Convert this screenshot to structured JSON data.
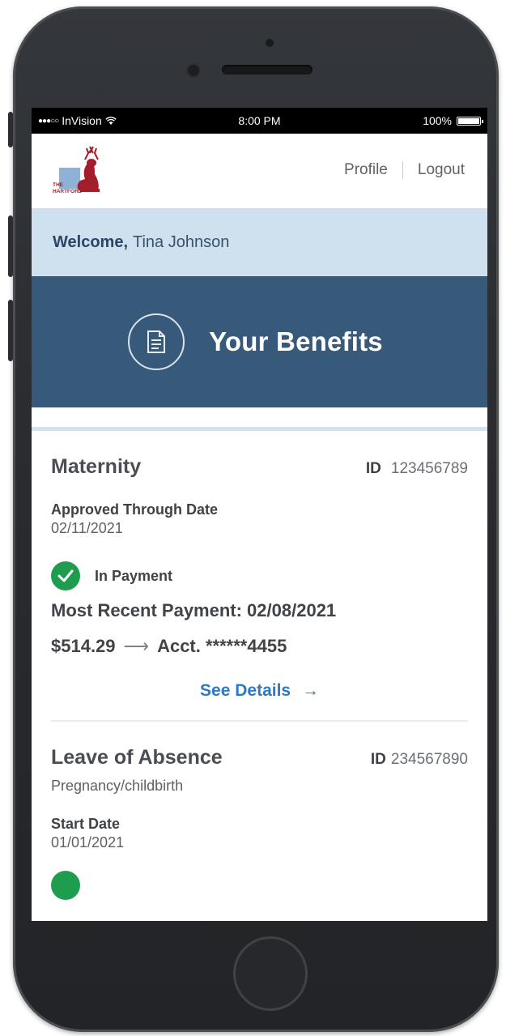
{
  "status_bar": {
    "carrier": "InVision",
    "signal_dots": "●●●○○",
    "time": "8:00 PM",
    "battery": "100%"
  },
  "header": {
    "logo_alt": "THE HARTFORD",
    "links": {
      "profile": "Profile",
      "logout": "Logout"
    }
  },
  "welcome": {
    "greeting": "Welcome,",
    "name": "Tina Johnson"
  },
  "hero": {
    "title": "Your Benefits",
    "icon": "document-icon"
  },
  "benefits": [
    {
      "title": "Maternity",
      "id_label": "ID",
      "id_value": "123456789",
      "approved_label": "Approved Through Date",
      "approved_value": "02/11/2021",
      "status": "In Payment",
      "recent_payment": "Most Recent Payment: 02/08/2021",
      "amount": "$514.29",
      "account": "Acct. ******4455",
      "details_link": "See Details"
    },
    {
      "title": "Leave of Absence",
      "id_label": "ID",
      "id_value": "234567890",
      "subtitle": "Pregnancy/childbirth",
      "start_label": "Start Date",
      "start_value": "01/01/2021"
    }
  ],
  "colors": {
    "welcome_bg": "#cfe0ef",
    "hero_bg": "#37597a",
    "link": "#2d79c4",
    "success": "#1f9d4f",
    "logo_red": "#a31d2a"
  }
}
